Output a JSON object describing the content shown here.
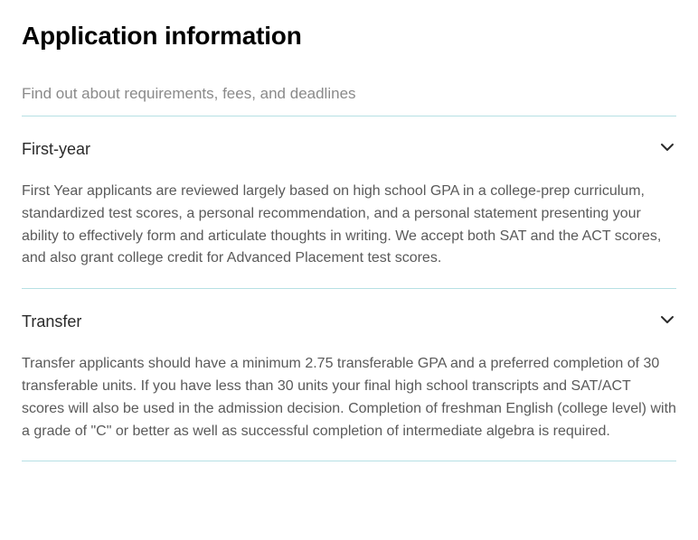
{
  "title": "Application information",
  "subtitle": "Find out about requirements, fees, and deadlines",
  "sections": [
    {
      "heading": "First-year",
      "body": "First Year applicants are reviewed largely based on high school GPA in a college-prep curriculum, standardized test scores, a personal recommendation, and a personal statement presenting your ability to effectively form and articulate thoughts in writing. We accept both SAT and the ACT scores, and also grant college credit for Advanced Placement test scores."
    },
    {
      "heading": "Transfer",
      "body": "Transfer applicants should have a minimum 2.75 transferable GPA and a preferred completion of 30 transferable units. If you have less than 30 units your final high school transcripts and SAT/ACT scores will also be used in the admission decision. Completion of freshman English (college level) with a grade of \"C\" or better as well as successful completion of intermediate algebra is required."
    }
  ]
}
